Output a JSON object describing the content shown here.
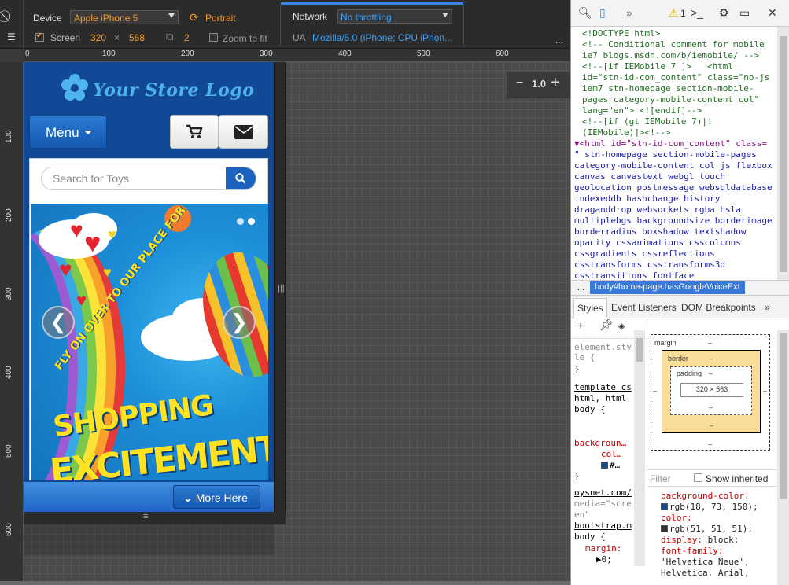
{
  "devbar": {
    "device_label": "Device",
    "device_value": "Apple iPhone 5",
    "orientation": "Portrait",
    "network_label": "Network",
    "network_value": "No throttling",
    "screen_label": "Screen",
    "screen_width": "320",
    "times": "×",
    "screen_height": "568",
    "pixel_ratio": "2",
    "zoom_to_fit": "Zoom to fit",
    "ua_label": "UA",
    "ua_value": "Mozilla/5.0 (iPhone; CPU iPhon..."
  },
  "ruler": {
    "top": [
      "0",
      "100",
      "200",
      "300",
      "400",
      "500",
      "600"
    ],
    "left": [
      "100",
      "200",
      "300",
      "400",
      "500",
      "600"
    ]
  },
  "zoom": {
    "minus": "−",
    "value": "1.0",
    "plus": "+"
  },
  "site": {
    "logo_text": "Your Store Logo",
    "menu_label": "Menu",
    "search_placeholder": "Search for Toys",
    "banner": {
      "tagline": "FLY ON OVER TO OUR PLACE FOR",
      "line1": "SHOPPING",
      "line2": "EXCITEMENT!"
    },
    "prev": "❮",
    "next": "❯",
    "more_label": "More Here",
    "colors": {
      "background": "#124996",
      "button": "#1c63c0",
      "logo": "#4fb4ee",
      "banner_text": "#ffe321"
    }
  },
  "devtools": {
    "warning_count": "1",
    "source_lines": [
      {
        "t": "cm",
        "s": "<!DOCTYPE html>"
      },
      {
        "t": "cm",
        "s": "<!-- Conditional comment for mobile"
      },
      {
        "t": "cm",
        "s": "ie7 blogs.msdn.com/b/iemobile/ -->"
      },
      {
        "t": "cm",
        "s": "<!--[if IEMobile 7 ]>   <html"
      },
      {
        "t": "cm",
        "s": "id=\"stn-id-com_content\" class=\"no-js"
      },
      {
        "t": "cm",
        "s": "iem7 stn-homepage section-mobile-"
      },
      {
        "t": "cm",
        "s": "pages category-mobile-content col\""
      },
      {
        "t": "cm",
        "s": "lang=\"en\"> <![endif]-->"
      },
      {
        "t": "cm",
        "s": "<!--[if (gt IEMobile 7)|!"
      },
      {
        "t": "cm",
        "s": "(IEMobile)]><!-->"
      },
      {
        "t": "tag",
        "s": "▼<html id=\"stn-id-com_content\" class="
      },
      {
        "t": "cls",
        "s": "\" stn-homepage section-mobile-pages"
      },
      {
        "t": "cls",
        "s": "category-mobile-content col js flexbox"
      },
      {
        "t": "cls",
        "s": "canvas canvastext webgl touch"
      },
      {
        "t": "cls",
        "s": "geolocation postmessage websqldatabase"
      },
      {
        "t": "cls",
        "s": "indexeddb hashchange history"
      },
      {
        "t": "cls",
        "s": "draganddrop websockets rgba hsla"
      },
      {
        "t": "cls",
        "s": "multiplebgs backgroundsize borderimage"
      },
      {
        "t": "cls",
        "s": "borderradius boxshadow textshadow"
      },
      {
        "t": "cls",
        "s": "opacity cssanimations csscolumns"
      },
      {
        "t": "cls",
        "s": "cssgradients cssreflections"
      },
      {
        "t": "cls",
        "s": "csstransforms csstransforms3d"
      },
      {
        "t": "cls",
        "s": "csstransitions fontface"
      }
    ],
    "crumb_dots": "...",
    "crumb": "body#home-page.hasGoogleVoiceExt",
    "tabs": [
      "Styles",
      "Event Listeners",
      "DOM Breakpoints"
    ],
    "tab_more": "»",
    "styles_lines": [
      "element.sty",
      "le {",
      "}",
      "template cs",
      "html, html",
      "body {",
      "backgroun…",
      "col…",
      "#…",
      "}",
      "oysnet.com/",
      "media=\"scre",
      "en\"",
      "bootstrap.m",
      "body {",
      "margin:",
      "▶0;"
    ],
    "boxmodel": {
      "margin": "margin",
      "border": "border",
      "padding": "padding",
      "dash": "–",
      "content": "320 × 563"
    },
    "filter_placeholder": "Filter",
    "show_inherited": "Show inherited",
    "computed": [
      {
        "name": "background-color:",
        "value": "rgb(18, 73, 150);",
        "swatch": "#124996"
      },
      {
        "name": "color:",
        "value": "rgb(51, 51, 51);",
        "swatch": "#333333"
      },
      {
        "name": "display:",
        "value": "block;"
      },
      {
        "name": "font-family:",
        "value": ""
      },
      {
        "name": "",
        "value": "'Helvetica Neue',"
      },
      {
        "name": "",
        "value": "Helvetica, Arial,"
      }
    ]
  }
}
